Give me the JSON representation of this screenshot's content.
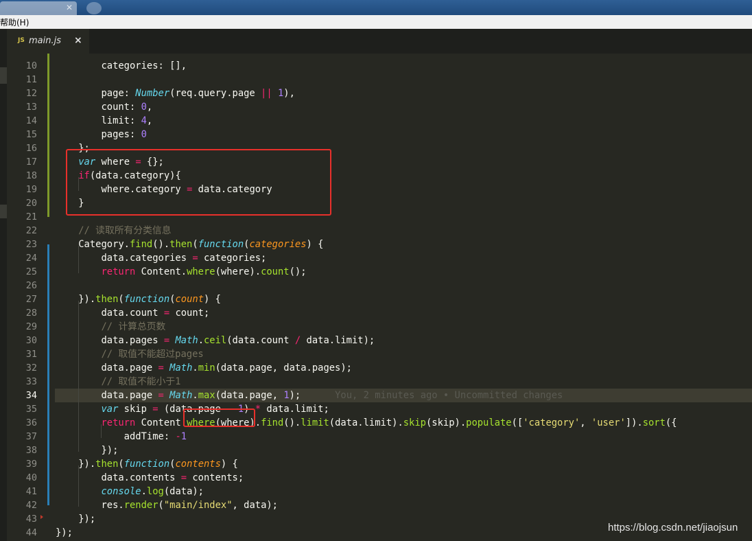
{
  "menu": {
    "help_label": "帮助(H)"
  },
  "tab": {
    "badge": "JS",
    "filename": "main.js",
    "close_glyph": "×"
  },
  "watermark": "https://blog.csdn.net/jiaojsun",
  "blame": "You, 2 minutes ago • Uncommitted changes",
  "current_line": 34,
  "lines": [
    {
      "n": 10,
      "tokens": [
        {
          "t": "        categories: [],",
          "c": ""
        }
      ]
    },
    {
      "n": 11,
      "tokens": []
    },
    {
      "n": 12,
      "tokens": [
        {
          "t": "        page: ",
          "c": ""
        },
        {
          "t": "Number",
          "c": "st"
        },
        {
          "t": "(req.query.page ",
          "c": ""
        },
        {
          "t": "||",
          "c": "kw"
        },
        {
          "t": " ",
          "c": ""
        },
        {
          "t": "1",
          "c": "num"
        },
        {
          "t": "),",
          "c": ""
        }
      ]
    },
    {
      "n": 13,
      "tokens": [
        {
          "t": "        count: ",
          "c": ""
        },
        {
          "t": "0",
          "c": "num"
        },
        {
          "t": ",",
          "c": ""
        }
      ]
    },
    {
      "n": 14,
      "tokens": [
        {
          "t": "        limit: ",
          "c": ""
        },
        {
          "t": "4",
          "c": "num"
        },
        {
          "t": ",",
          "c": ""
        }
      ]
    },
    {
      "n": 15,
      "tokens": [
        {
          "t": "        pages: ",
          "c": ""
        },
        {
          "t": "0",
          "c": "num"
        }
      ]
    },
    {
      "n": 16,
      "tokens": [
        {
          "t": "    };",
          "c": ""
        }
      ]
    },
    {
      "n": 17,
      "tokens": [
        {
          "t": "    ",
          "c": ""
        },
        {
          "t": "var",
          "c": "st"
        },
        {
          "t": " where ",
          "c": ""
        },
        {
          "t": "=",
          "c": "kw"
        },
        {
          "t": " {};",
          "c": ""
        }
      ]
    },
    {
      "n": 18,
      "tokens": [
        {
          "t": "    ",
          "c": ""
        },
        {
          "t": "if",
          "c": "kw"
        },
        {
          "t": "(data.category){",
          "c": ""
        }
      ]
    },
    {
      "n": 19,
      "tokens": [
        {
          "t": "        where.category ",
          "c": ""
        },
        {
          "t": "=",
          "c": "kw"
        },
        {
          "t": " data.category",
          "c": ""
        }
      ]
    },
    {
      "n": 20,
      "tokens": [
        {
          "t": "    }",
          "c": ""
        }
      ]
    },
    {
      "n": 21,
      "tokens": []
    },
    {
      "n": 22,
      "tokens": [
        {
          "t": "    // 读取所有分类信息",
          "c": "cm"
        }
      ]
    },
    {
      "n": 23,
      "tokens": [
        {
          "t": "    Category.",
          "c": ""
        },
        {
          "t": "find",
          "c": "fn"
        },
        {
          "t": "().",
          "c": ""
        },
        {
          "t": "then",
          "c": "fn"
        },
        {
          "t": "(",
          "c": ""
        },
        {
          "t": "function",
          "c": "st"
        },
        {
          "t": "(",
          "c": ""
        },
        {
          "t": "categories",
          "c": "par"
        },
        {
          "t": ") {",
          "c": ""
        }
      ]
    },
    {
      "n": 24,
      "tokens": [
        {
          "t": "        data.categories ",
          "c": ""
        },
        {
          "t": "=",
          "c": "kw"
        },
        {
          "t": " categories;",
          "c": ""
        }
      ]
    },
    {
      "n": 25,
      "tokens": [
        {
          "t": "        ",
          "c": ""
        },
        {
          "t": "return",
          "c": "kw"
        },
        {
          "t": " Content.",
          "c": ""
        },
        {
          "t": "where",
          "c": "fn"
        },
        {
          "t": "(where).",
          "c": ""
        },
        {
          "t": "count",
          "c": "fn"
        },
        {
          "t": "();",
          "c": ""
        }
      ]
    },
    {
      "n": 26,
      "tokens": []
    },
    {
      "n": 27,
      "tokens": [
        {
          "t": "    }).",
          "c": ""
        },
        {
          "t": "then",
          "c": "fn"
        },
        {
          "t": "(",
          "c": ""
        },
        {
          "t": "function",
          "c": "st"
        },
        {
          "t": "(",
          "c": ""
        },
        {
          "t": "count",
          "c": "par"
        },
        {
          "t": ") {",
          "c": ""
        }
      ]
    },
    {
      "n": 28,
      "tokens": [
        {
          "t": "        data.count ",
          "c": ""
        },
        {
          "t": "=",
          "c": "kw"
        },
        {
          "t": " count;",
          "c": ""
        }
      ]
    },
    {
      "n": 29,
      "tokens": [
        {
          "t": "        // 计算总页数",
          "c": "cm"
        }
      ]
    },
    {
      "n": 30,
      "tokens": [
        {
          "t": "        data.pages ",
          "c": ""
        },
        {
          "t": "=",
          "c": "kw"
        },
        {
          "t": " ",
          "c": ""
        },
        {
          "t": "Math",
          "c": "st"
        },
        {
          "t": ".",
          "c": ""
        },
        {
          "t": "ceil",
          "c": "fn"
        },
        {
          "t": "(data.count ",
          "c": ""
        },
        {
          "t": "/",
          "c": "kw"
        },
        {
          "t": " data.limit);",
          "c": ""
        }
      ]
    },
    {
      "n": 31,
      "tokens": [
        {
          "t": "        // 取值不能超过pages",
          "c": "cm"
        }
      ]
    },
    {
      "n": 32,
      "tokens": [
        {
          "t": "        data.page ",
          "c": ""
        },
        {
          "t": "=",
          "c": "kw"
        },
        {
          "t": " ",
          "c": ""
        },
        {
          "t": "Math",
          "c": "st"
        },
        {
          "t": ".",
          "c": ""
        },
        {
          "t": "min",
          "c": "fn"
        },
        {
          "t": "(data.page, data.pages);",
          "c": ""
        }
      ]
    },
    {
      "n": 33,
      "tokens": [
        {
          "t": "        // 取值不能小于1",
          "c": "cm"
        }
      ]
    },
    {
      "n": 34,
      "tokens": [
        {
          "t": "        data.page ",
          "c": ""
        },
        {
          "t": "=",
          "c": "kw"
        },
        {
          "t": " ",
          "c": ""
        },
        {
          "t": "Math",
          "c": "st"
        },
        {
          "t": ".",
          "c": ""
        },
        {
          "t": "max",
          "c": "fn"
        },
        {
          "t": "(data.page, ",
          "c": ""
        },
        {
          "t": "1",
          "c": "num"
        },
        {
          "t": ");",
          "c": ""
        },
        {
          "t": "      ",
          "c": ""
        },
        {
          "t": "You, 2 minutes ago • Uncommitted changes",
          "c": "blame"
        }
      ]
    },
    {
      "n": 35,
      "tokens": [
        {
          "t": "        ",
          "c": ""
        },
        {
          "t": "var",
          "c": "st"
        },
        {
          "t": " skip ",
          "c": ""
        },
        {
          "t": "=",
          "c": "kw"
        },
        {
          "t": " (data.page ",
          "c": ""
        },
        {
          "t": "-",
          "c": "kw"
        },
        {
          "t": " ",
          "c": ""
        },
        {
          "t": "1",
          "c": "num"
        },
        {
          "t": ") ",
          "c": ""
        },
        {
          "t": "*",
          "c": "kw"
        },
        {
          "t": " data.limit;",
          "c": ""
        }
      ]
    },
    {
      "n": 36,
      "tokens": [
        {
          "t": "        ",
          "c": ""
        },
        {
          "t": "return",
          "c": "kw"
        },
        {
          "t": " Content.",
          "c": ""
        },
        {
          "t": "where",
          "c": "fn"
        },
        {
          "t": "(where).",
          "c": ""
        },
        {
          "t": "find",
          "c": "fn"
        },
        {
          "t": "().",
          "c": ""
        },
        {
          "t": "limit",
          "c": "fn"
        },
        {
          "t": "(data.limit).",
          "c": ""
        },
        {
          "t": "skip",
          "c": "fn"
        },
        {
          "t": "(skip).",
          "c": ""
        },
        {
          "t": "populate",
          "c": "fn"
        },
        {
          "t": "([",
          "c": ""
        },
        {
          "t": "'category'",
          "c": "str"
        },
        {
          "t": ", ",
          "c": ""
        },
        {
          "t": "'user'",
          "c": "str"
        },
        {
          "t": "]).",
          "c": ""
        },
        {
          "t": "sort",
          "c": "fn"
        },
        {
          "t": "({",
          "c": ""
        }
      ]
    },
    {
      "n": 37,
      "tokens": [
        {
          "t": "            addTime: ",
          "c": ""
        },
        {
          "t": "-",
          "c": "kw"
        },
        {
          "t": "1",
          "c": "num"
        }
      ]
    },
    {
      "n": 38,
      "tokens": [
        {
          "t": "        });",
          "c": ""
        }
      ]
    },
    {
      "n": 39,
      "tokens": [
        {
          "t": "    }).",
          "c": ""
        },
        {
          "t": "then",
          "c": "fn"
        },
        {
          "t": "(",
          "c": ""
        },
        {
          "t": "function",
          "c": "st"
        },
        {
          "t": "(",
          "c": ""
        },
        {
          "t": "contents",
          "c": "par"
        },
        {
          "t": ") {",
          "c": ""
        }
      ]
    },
    {
      "n": 40,
      "tokens": [
        {
          "t": "        data.contents ",
          "c": ""
        },
        {
          "t": "=",
          "c": "kw"
        },
        {
          "t": " contents;",
          "c": ""
        }
      ]
    },
    {
      "n": 41,
      "tokens": [
        {
          "t": "        ",
          "c": ""
        },
        {
          "t": "console",
          "c": "st"
        },
        {
          "t": ".",
          "c": ""
        },
        {
          "t": "log",
          "c": "fn"
        },
        {
          "t": "(data);",
          "c": ""
        }
      ]
    },
    {
      "n": 42,
      "tokens": [
        {
          "t": "        res.",
          "c": ""
        },
        {
          "t": "render",
          "c": "fn"
        },
        {
          "t": "(",
          "c": ""
        },
        {
          "t": "\"main/index\"",
          "c": "str"
        },
        {
          "t": ", data);",
          "c": ""
        }
      ]
    },
    {
      "n": 43,
      "tokens": [
        {
          "t": "    });",
          "c": ""
        }
      ]
    },
    {
      "n": 44,
      "tokens": [
        {
          "t": "});",
          "c": ""
        }
      ]
    }
  ]
}
